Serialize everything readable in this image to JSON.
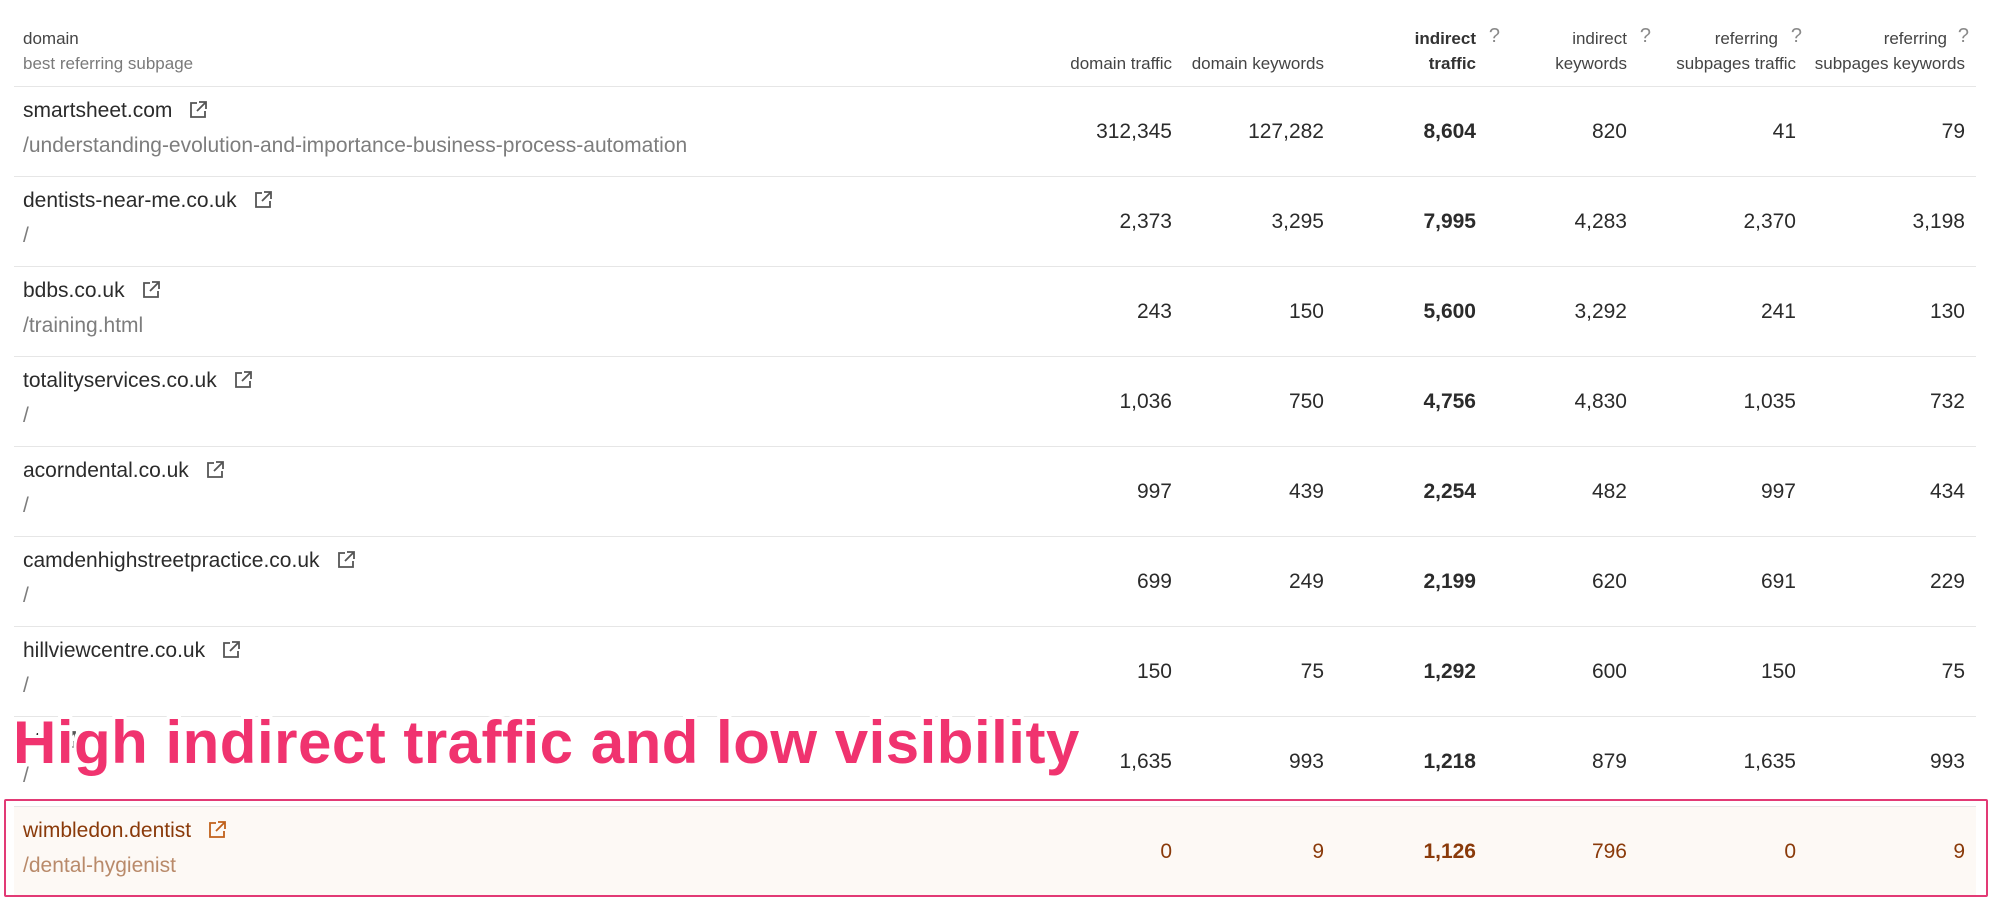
{
  "header": {
    "domain": "domain",
    "domain_sub": "best referring subpage",
    "domain_traffic": "domain traffic",
    "domain_keywords": "domain keywords",
    "indirect_traffic_1": "indirect",
    "indirect_traffic_2": "traffic",
    "indirect_keywords_1": "indirect",
    "indirect_keywords_2": "keywords",
    "ref_sub_traffic_1": "referring",
    "ref_sub_traffic_2": "subpages traffic",
    "ref_sub_keywords_1": "referring",
    "ref_sub_keywords_2": "subpages keywords",
    "help": "?"
  },
  "rows": [
    {
      "domain": "smartsheet.com",
      "path": "/understanding-evolution-and-importance-business-process-automation",
      "domain_traffic": "312,345",
      "domain_keywords": "127,282",
      "indirect_traffic": "8,604",
      "indirect_keywords": "820",
      "ref_sub_traffic": "41",
      "ref_sub_keywords": "79"
    },
    {
      "domain": "dentists-near-me.co.uk",
      "path": "/",
      "domain_traffic": "2,373",
      "domain_keywords": "3,295",
      "indirect_traffic": "7,995",
      "indirect_keywords": "4,283",
      "ref_sub_traffic": "2,370",
      "ref_sub_keywords": "3,198"
    },
    {
      "domain": "bdbs.co.uk",
      "path": "/training.html",
      "domain_traffic": "243",
      "domain_keywords": "150",
      "indirect_traffic": "5,600",
      "indirect_keywords": "3,292",
      "ref_sub_traffic": "241",
      "ref_sub_keywords": "130"
    },
    {
      "domain": "totalityservices.co.uk",
      "path": "/",
      "domain_traffic": "1,036",
      "domain_keywords": "750",
      "indirect_traffic": "4,756",
      "indirect_keywords": "4,830",
      "ref_sub_traffic": "1,035",
      "ref_sub_keywords": "732"
    },
    {
      "domain": "acorndental.co.uk",
      "path": "/",
      "domain_traffic": "997",
      "domain_keywords": "439",
      "indirect_traffic": "2,254",
      "indirect_keywords": "482",
      "ref_sub_traffic": "997",
      "ref_sub_keywords": "434"
    },
    {
      "domain": "camdenhighstreetpractice.co.uk",
      "path": "/",
      "domain_traffic": "699",
      "domain_keywords": "249",
      "indirect_traffic": "2,199",
      "indirect_keywords": "620",
      "ref_sub_traffic": "691",
      "ref_sub_keywords": "229"
    },
    {
      "domain": "hillviewcentre.co.uk",
      "path": "/",
      "domain_traffic": "150",
      "domain_keywords": "75",
      "indirect_traffic": "1,292",
      "indirect_keywords": "600",
      "ref_sub_traffic": "150",
      "ref_sub_keywords": "75"
    },
    {
      "domain": "nt",
      "path": "/",
      "domain_traffic": "1,635",
      "domain_keywords": "993",
      "indirect_traffic": "1,218",
      "indirect_keywords": "879",
      "ref_sub_traffic": "1,635",
      "ref_sub_keywords": "993"
    },
    {
      "domain": "wimbledon.dentist",
      "path": "/dental-hygienist",
      "domain_traffic": "0",
      "domain_keywords": "9",
      "indirect_traffic": "1,126",
      "indirect_keywords": "796",
      "ref_sub_traffic": "0",
      "ref_sub_keywords": "9"
    }
  ],
  "overlay_text": "High indirect traffic and low visibility",
  "colors": {
    "highlight_border": "#e23a75",
    "overlay_text": "#f0336f",
    "highlight_text": "#8a3a0a"
  }
}
